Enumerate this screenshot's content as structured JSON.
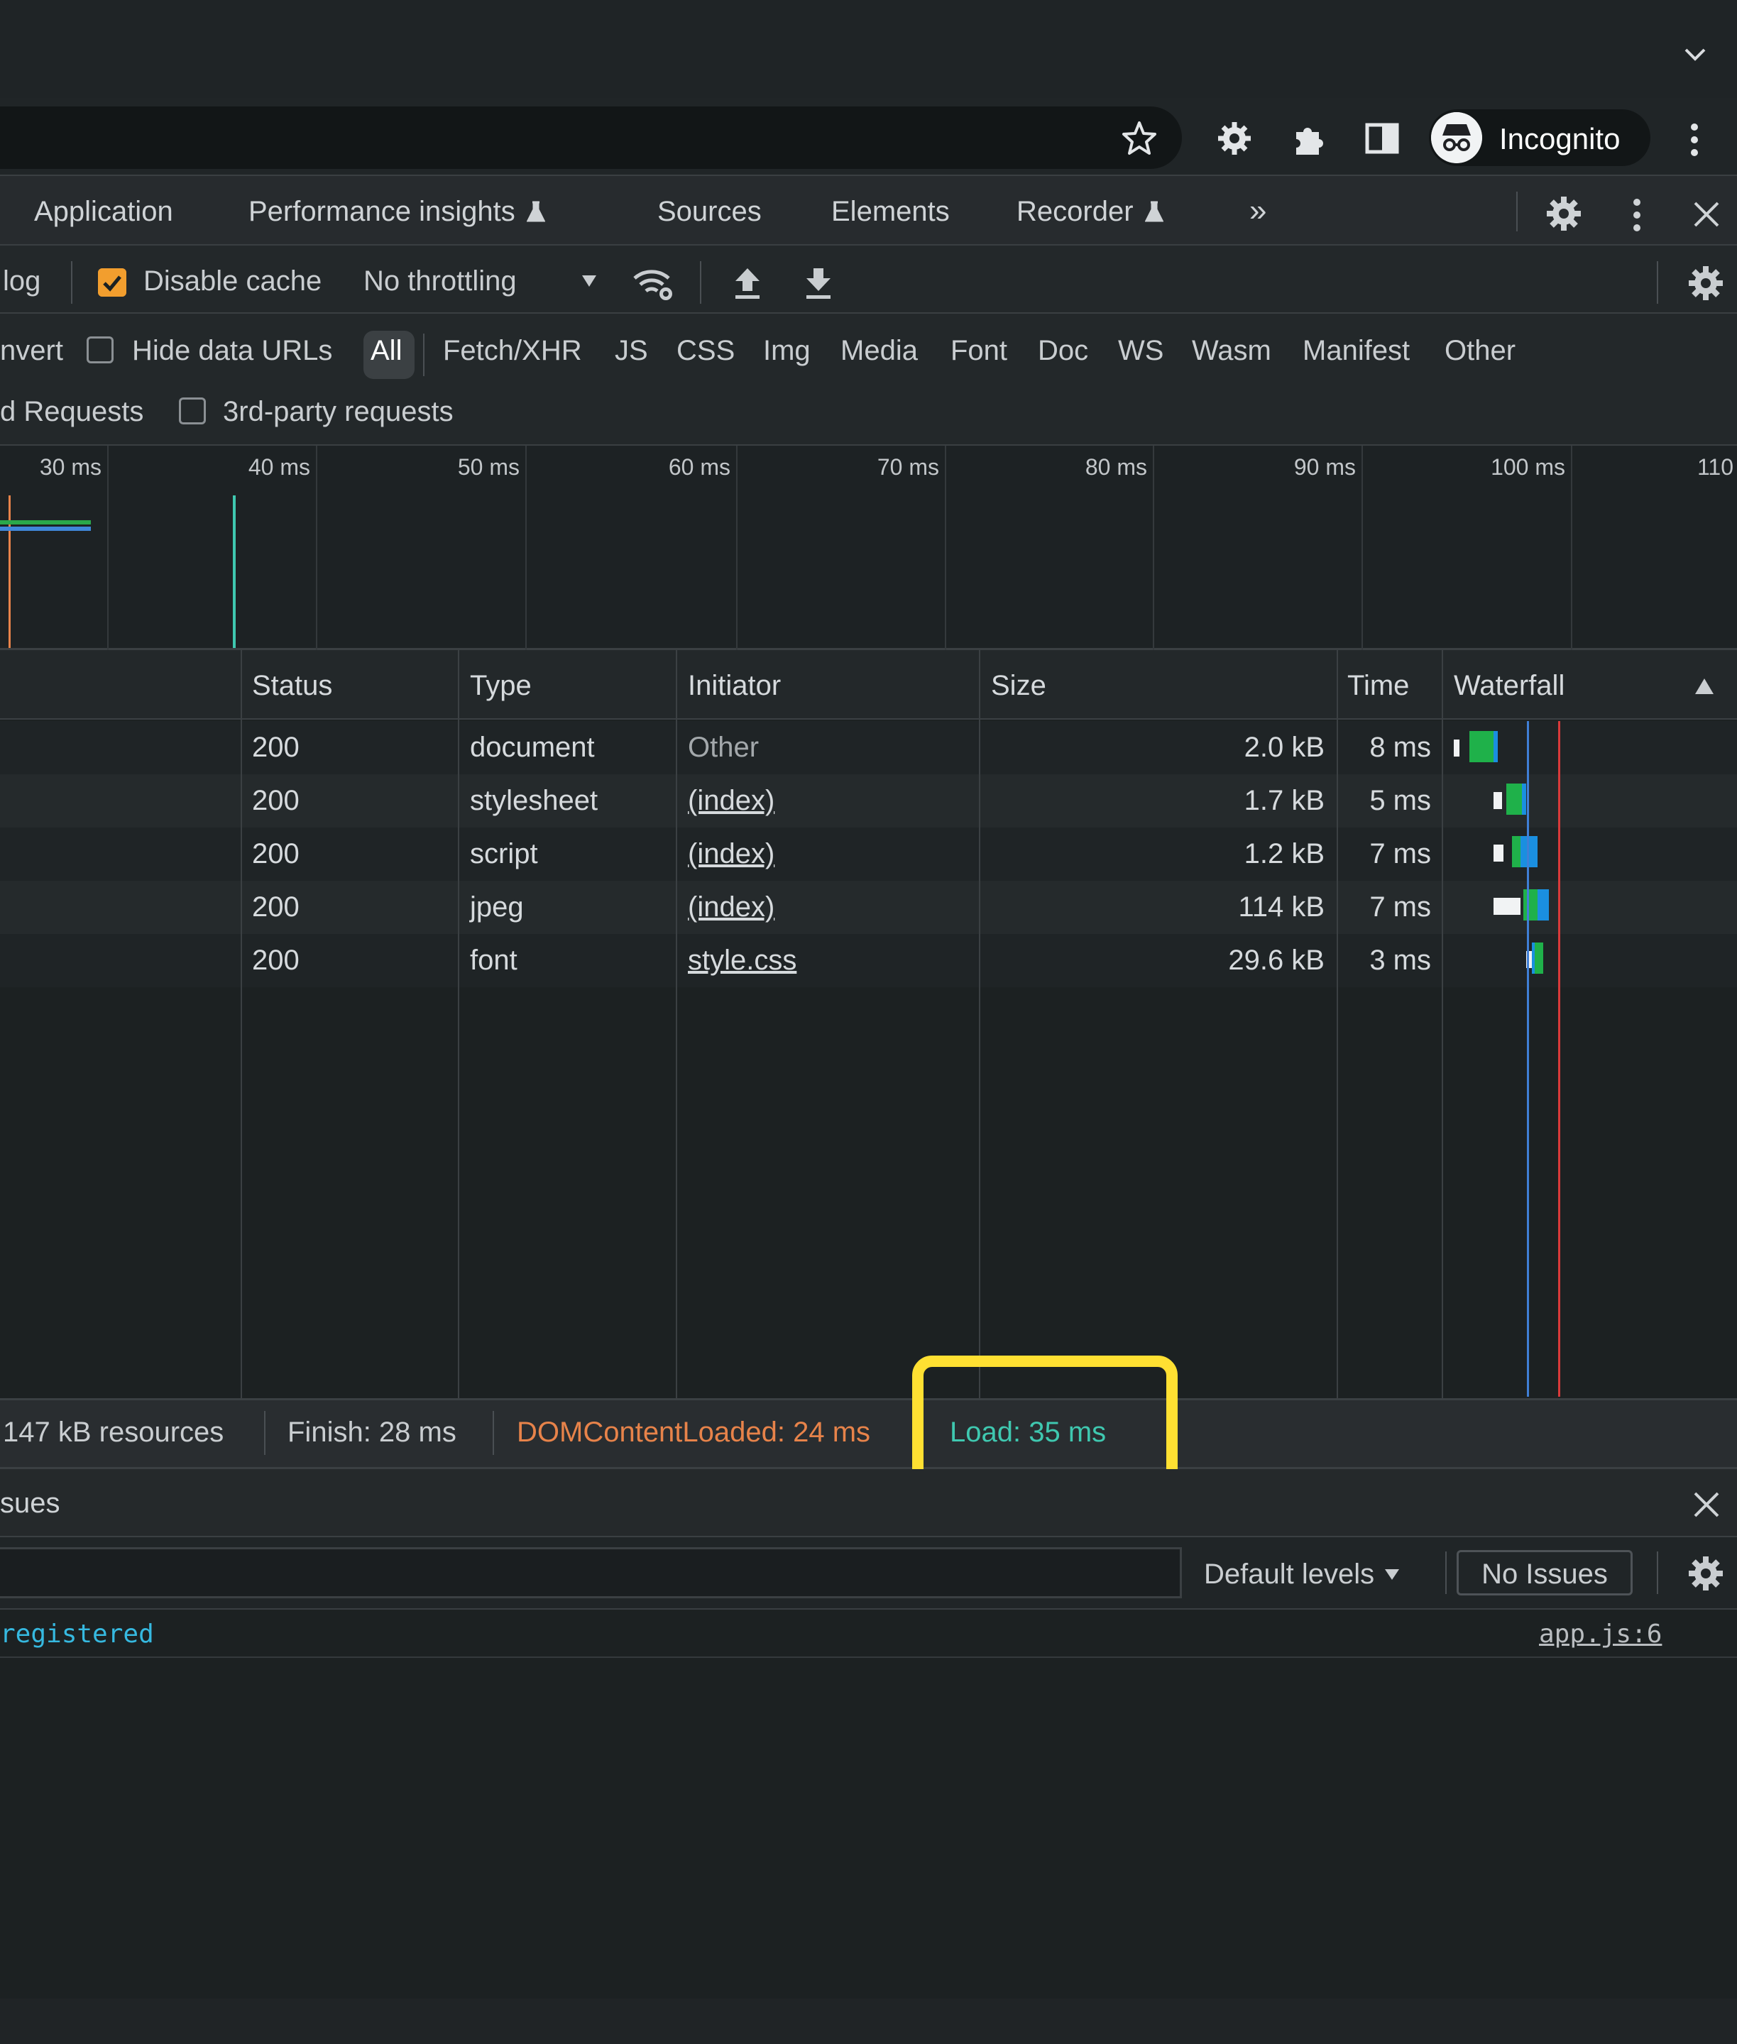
{
  "browser": {
    "profile_label": "Incognito"
  },
  "devtools": {
    "tabs": [
      {
        "label": "Application"
      },
      {
        "label": "Performance insights"
      },
      {
        "label": "Sources"
      },
      {
        "label": "Elements"
      },
      {
        "label": "Recorder"
      }
    ],
    "more_tabs": "»"
  },
  "network_toolbar": {
    "preserve_log_fragment": "log",
    "disable_cache_label": "Disable cache",
    "disable_cache_checked": true,
    "throttling_value": "No throttling"
  },
  "filter_bar": {
    "invert_fragment": "nvert",
    "hide_data_urls_label": "Hide data URLs",
    "type_filters": [
      "All",
      "Fetch/XHR",
      "JS",
      "CSS",
      "Img",
      "Media",
      "Font",
      "Doc",
      "WS",
      "Wasm",
      "Manifest",
      "Other"
    ],
    "active_type_filter": "All",
    "blocked_requests_fragment": "d Requests",
    "third_party_label": "3rd-party requests"
  },
  "overview": {
    "tick_labels": [
      "30 ms",
      "40 ms",
      "50 ms",
      "60 ms",
      "70 ms",
      "80 ms",
      "90 ms",
      "100 ms",
      "110"
    ]
  },
  "table": {
    "columns": [
      "Status",
      "Type",
      "Initiator",
      "Size",
      "Time",
      "Waterfall"
    ],
    "rows": [
      {
        "status": "200",
        "type": "document",
        "initiator": "Other",
        "size": "2.0 kB",
        "time": "8 ms"
      },
      {
        "status": "200",
        "type": "stylesheet",
        "initiator": "(index)",
        "size": "1.7 kB",
        "time": "5 ms"
      },
      {
        "status": "200",
        "type": "script",
        "initiator": "(index)",
        "size": "1.2 kB",
        "time": "7 ms"
      },
      {
        "status": "200",
        "type": "jpeg",
        "initiator": "(index)",
        "size": "114 kB",
        "time": "7 ms"
      },
      {
        "status": "200",
        "type": "font",
        "initiator": "style.css",
        "size": "29.6 kB",
        "time": "3 ms"
      }
    ]
  },
  "summary": {
    "resources": "147 kB resources",
    "finish": "Finish: 28 ms",
    "dom_content_loaded": "DOMContentLoaded: 24 ms",
    "load": "Load: 35 ms"
  },
  "drawer": {
    "title_fragment": "sues",
    "levels_label": "Default levels",
    "issues_label": "No Issues",
    "log_message": "registered",
    "log_source": "app.js:6"
  },
  "colors": {
    "dom_content_loaded": "#e7834a",
    "load": "#3fc8b0",
    "highlight": "#ffe032",
    "checkbox_checked": "#f29e2e"
  }
}
